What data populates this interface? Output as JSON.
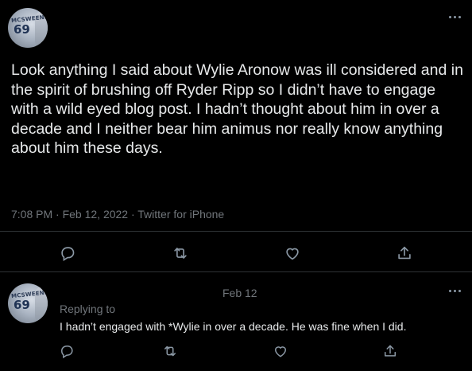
{
  "main_tweet": {
    "text": "Look anything I said about Wylie Aronow was ill considered and in the spirit of brushing off Ryder Ripp so I didn’t have to engage with a wild eyed blog post. I hadn’t thought about him in over a decade and I neither bear him animus nor really know anything about him these days.",
    "timestamp": "7:08 PM · Feb 12, 2022 · Twitter for iPhone",
    "avatar": {
      "jersey_text": "MCSWEENEY",
      "jersey_number": "69"
    }
  },
  "reply_tweet": {
    "date": "Feb 12",
    "replying_to_label": "Replying to",
    "text": "I hadn’t engaged with *Wylie in over a decade. He was fine when I did.",
    "avatar": {
      "jersey_text": "MCSWEENEY",
      "jersey_number": "69"
    }
  },
  "icons": {
    "reply": "reply-icon",
    "retweet": "retweet-icon",
    "like": "heart-icon",
    "share": "share-icon",
    "more": "more-icon"
  },
  "colors": {
    "background": "#000000",
    "text": "#e7e9ea",
    "muted": "#71767b",
    "divider": "#2f3336"
  }
}
